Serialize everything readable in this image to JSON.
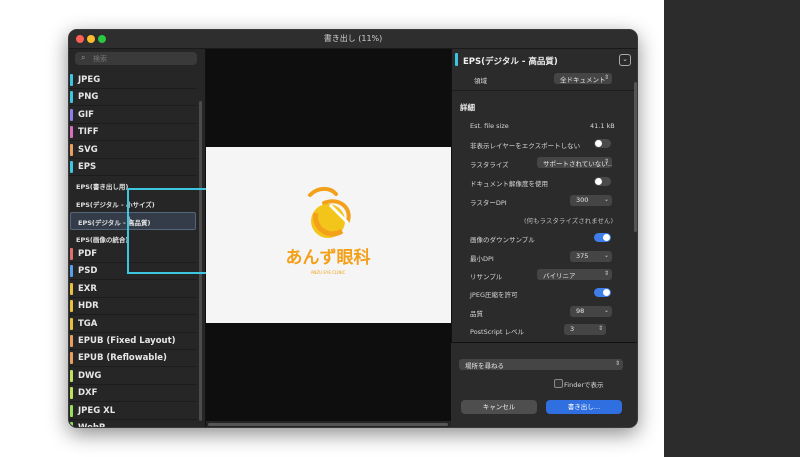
{
  "window": {
    "title": "書き出し (11%)"
  },
  "sidebar": {
    "search_placeholder": "検索",
    "formats": [
      {
        "label": "JPEG",
        "color": "#3cc6e0"
      },
      {
        "label": "PNG",
        "color": "#3cc6e0"
      },
      {
        "label": "GIF",
        "color": "#8f7de8"
      },
      {
        "label": "TIFF",
        "color": "#d870c0"
      },
      {
        "label": "SVG",
        "color": "#e8a060"
      },
      {
        "label": "EPS",
        "color": "#3cc6e0"
      },
      {
        "label": "PDF",
        "color": "#e07070"
      },
      {
        "label": "PSD",
        "color": "#5aa0e8"
      },
      {
        "label": "EXR",
        "color": "#e8c040"
      },
      {
        "label": "HDR",
        "color": "#e8c040"
      },
      {
        "label": "TGA",
        "color": "#e8c040"
      },
      {
        "label": "EPUB (Fixed Layout)",
        "color": "#e8a060"
      },
      {
        "label": "EPUB (Reflowable)",
        "color": "#e8a060"
      },
      {
        "label": "DWG",
        "color": "#c0e060"
      },
      {
        "label": "DXF",
        "color": "#c0e060"
      },
      {
        "label": "JPEG XL",
        "color": "#9ae060"
      },
      {
        "label": "WebP",
        "color": "#9ae060"
      }
    ],
    "eps_presets": [
      {
        "label": "EPS(書き出し用)"
      },
      {
        "label": "EPS(デジタル - 小サイズ)"
      },
      {
        "label": "EPS(デジタル - 高品質)"
      },
      {
        "label": "EPS(画像の統合)"
      }
    ]
  },
  "preview": {
    "logo_text": "あんず眼科",
    "logo_subtext": "ANZU EYE CLINIC"
  },
  "panel": {
    "header": "EPS(デジタル - 高品質)",
    "area_label": "領域",
    "area_value": "全ドキュメント",
    "details_heading": "詳細",
    "est_file_size_label": "Est. file size",
    "est_file_size_value": "41.1 kB",
    "hidden_layers_label": "非表示レイヤーをエクスポートしない",
    "rasterize_label": "ラスタライズ",
    "rasterize_value": "サポートされていない…",
    "doc_resolution_label": "ドキュメント解像度を使用",
    "raster_dpi_label": "ラスターDPI",
    "raster_dpi_value": "300",
    "raster_note": "(何もラスタライズされません)",
    "downsample_label": "画像のダウンサンプル",
    "min_dpi_label": "最小DPI",
    "min_dpi_value": "375",
    "resample_label": "リサンプル",
    "resample_value": "バイリニア",
    "jpeg_label": "JPEG圧縮を許可",
    "quality_label": "品質",
    "quality_value": "98",
    "ps_level_label": "PostScript レベル",
    "ps_level_value": "3",
    "location_value": "場所を尋ねる",
    "finder_label": "Finderで表示",
    "cancel_label": "キャンセル",
    "export_label": "書き出し…"
  },
  "colors": {
    "accent": "#3cc6e0",
    "primary_button": "#2f6fe0",
    "logo_orange": "#f3a01a"
  }
}
